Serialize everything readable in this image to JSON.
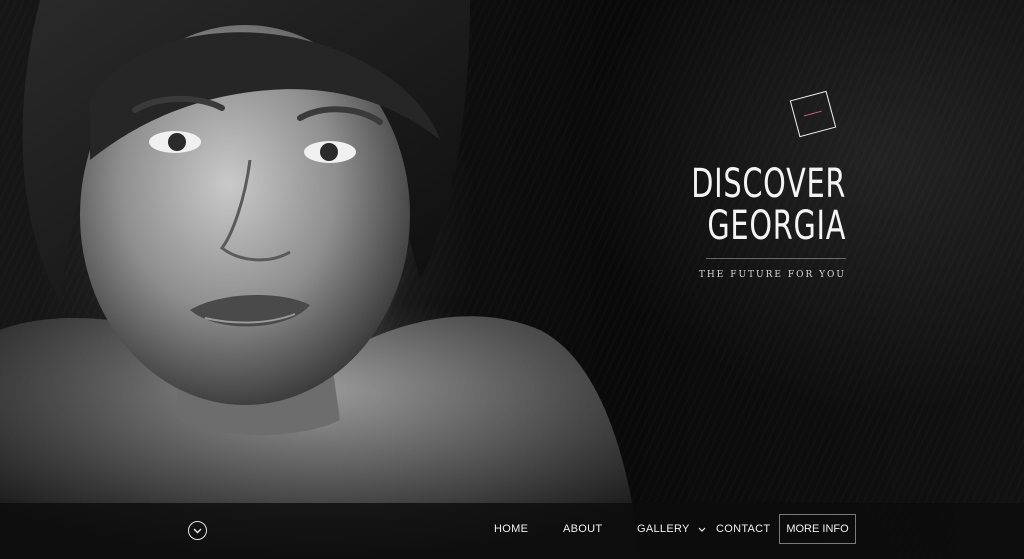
{
  "hero": {
    "title_line1": "DISCOVER",
    "title_line2": "GEORGIA",
    "subtitle": "THE FUTURE FOR YOU",
    "logo_icon": "square-logo-icon",
    "accent_color": "#d05a7a"
  },
  "nav": {
    "scroll_icon": "chevron-down-circle-icon",
    "items": [
      {
        "label": "HOME"
      },
      {
        "label": "ABOUT"
      },
      {
        "label": "GALLERY",
        "icon": "chevron-down-icon"
      },
      {
        "label": "CONTACT"
      }
    ],
    "cta_label": "MORE INFO"
  },
  "background": {
    "image": "portrait-photo",
    "palette": [
      "#0b0b0b",
      "#f4f4f4"
    ]
  }
}
